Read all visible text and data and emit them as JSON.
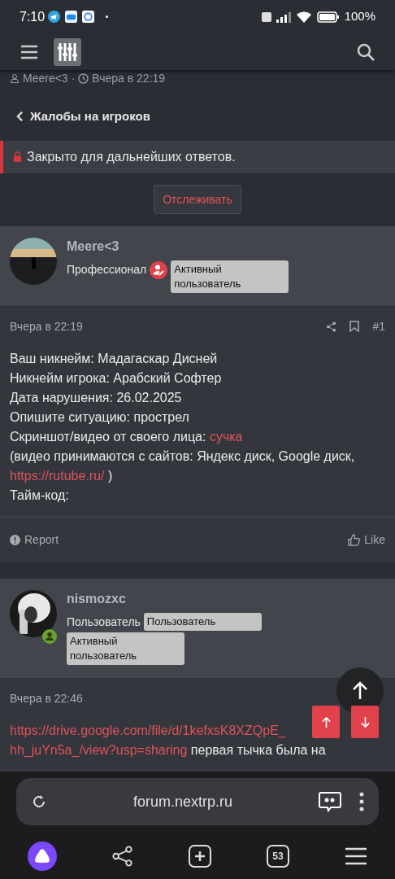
{
  "status_bar": {
    "time": "7:10",
    "battery": "100%"
  },
  "thread_meta": {
    "author": "Meere<3",
    "separator": "·",
    "time": "Вчера в 22:19"
  },
  "back_link": "Жалобы на игроков",
  "closed_notice": "Закрыто для дальнейших ответов.",
  "follow_button": "Отслеживать",
  "posts": [
    {
      "author": "Meere<3",
      "online": false,
      "title": "Профессионал",
      "has_role_icon": true,
      "banners": [
        "Активный пользователь"
      ],
      "time": "Вчера в 22:19",
      "number": "#1",
      "lines": [
        [
          {
            "kind": "text",
            "text": "Ваш никнейм: Мадагаскар Дисней"
          }
        ],
        [
          {
            "kind": "text",
            "text": "Никнейм игрока: Арабский Софтер"
          }
        ],
        [
          {
            "kind": "text",
            "text": "Дата нарушения: 26.02.2025"
          }
        ],
        [
          {
            "kind": "text",
            "text": "Опишите ситуацию: прострел"
          }
        ],
        [
          {
            "kind": "text",
            "text": "Скриншот/видео от своего лица: "
          },
          {
            "kind": "link",
            "text": "сучка"
          }
        ],
        [
          {
            "kind": "text",
            "text": "(видео принимаются с сайтов: Яндекс диск, Google диск, "
          },
          {
            "kind": "link",
            "text": "https://rutube.ru/"
          },
          {
            "kind": "text",
            "text": " )"
          }
        ],
        [
          {
            "kind": "text",
            "text": "Тайм-код:"
          }
        ]
      ],
      "actions": [
        "Report",
        "Like"
      ]
    },
    {
      "author": "nismozxc",
      "online": true,
      "title": "Пользователь",
      "has_role_icon": false,
      "banners": [
        "Пользователь",
        "Активный пользователь"
      ],
      "time": "Вчера в 22:46",
      "lines": [
        [
          {
            "kind": "link",
            "text": "https://drive.google.com/file/d/1kefxsK8XZQpE_"
          }
        ],
        [
          {
            "kind": "link",
            "text": "hh_juYn5a_/view?usp=sharing"
          },
          {
            "kind": "text",
            "text": " первая тычка была на"
          }
        ]
      ]
    }
  ],
  "browser": {
    "url": "forum.nextrp.ru",
    "tab_count": "53"
  }
}
